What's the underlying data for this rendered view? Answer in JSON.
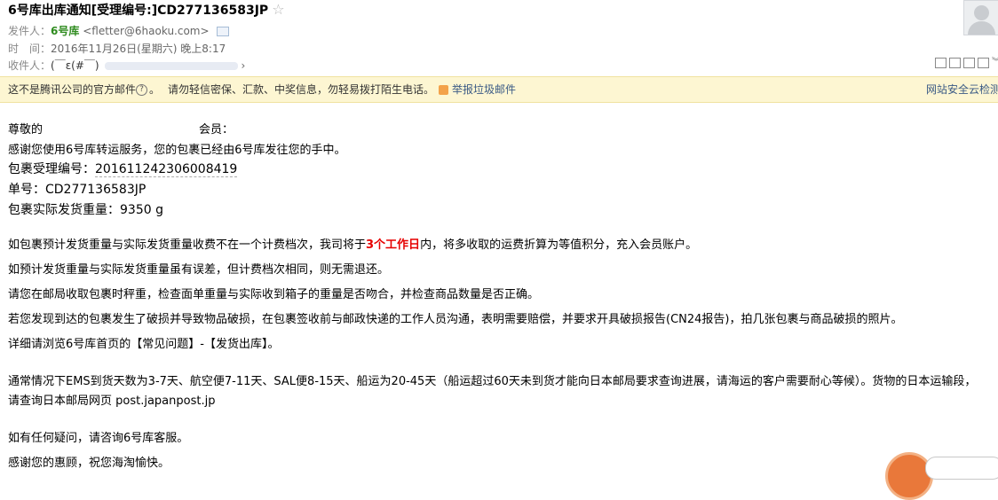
{
  "header": {
    "subject": "6号库出库通知[受理编号:]CD277136583JP",
    "star_icon": "star-outline-icon",
    "from_label": "发件人：",
    "from_name": "6号库",
    "from_email": "<fletter@6haoku.com>",
    "time_label": "时　间：",
    "time_value": "2016年11月26日(星期六) 晚上8:17",
    "to_label": "收件人：",
    "to_value": "(￣ε(#￣)",
    "to_more": "›"
  },
  "warning_bar": {
    "left_text": "这不是腾讯公司的官方邮件",
    "help_glyph": "?",
    "after_help": "。",
    "middle_text": "请勿轻信密保、汇款、中奖信息，勿轻易拨打陌生电话。",
    "report_link": "举报垃圾邮件",
    "right_link": "网站安全云检测"
  },
  "body": {
    "greeting_prefix": "尊敬的",
    "greeting_suffix": "会员：",
    "line_thanks": "感谢您使用6号库转运服务，您的包裹已经由6号库发往您的手中。",
    "accept_label": "包裹受理编号：",
    "accept_no": "201611242306008419",
    "tracking_label": "单号：",
    "tracking_no": "CD277136583JP",
    "weight_label": "包裹实际发货重量：",
    "weight_value": "9350 g",
    "p1_a": "如包裹预计发货重量与实际发货重量收费不在一个计费档次，我司将于",
    "p1_red": "3个工作日",
    "p1_b": "内，将多收取的运费折算为等值积分，充入会员账户。",
    "p2": "如预计发货重量与实际发货重量虽有误差，但计费档次相同，则无需退还。",
    "p3": "请您在邮局收取包裹时秤重，检查面单重量与实际收到箱子的重量是否吻合，并检查商品数量是否正确。",
    "p4": "若您发现到达的包裹发生了破损并导致物品破损，在包裹签收前与邮政快递的工作人员沟通，表明需要赔偿，并要求开具破损报告(CN24报告)，拍几张包裹与商品破损的照片。",
    "p5": "详细请浏览6号库首页的【常见问题】-【发货出库】。",
    "p6": "通常情况下EMS到货天数为3-7天、航空便7-11天、SAL便8-15天、船运为20-45天（船运超过60天未到货才能向日本邮局要求查询进展，请海运的客户需要耐心等候）。货物的日本运输段，请查询日本邮局网页 post.japanpost.jp",
    "p7": "如有任何疑问，请咨询6号库客服。",
    "p8": "感谢您的惠顾，祝您海淘愉快。"
  }
}
